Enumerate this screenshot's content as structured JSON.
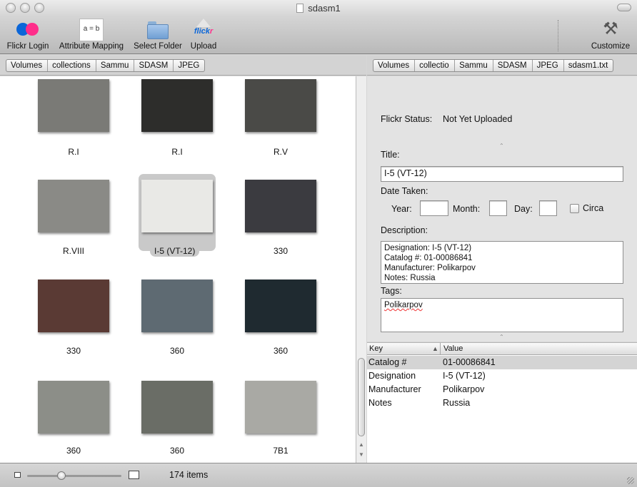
{
  "window": {
    "title": "sdasm1"
  },
  "toolbar": {
    "items": [
      {
        "label": "Flickr Login",
        "icon": "flickr-dots-icon"
      },
      {
        "label": "Attribute Mapping",
        "icon": "a-equals-b-icon",
        "icon_text": "a = b"
      },
      {
        "label": "Select Folder",
        "icon": "folder-icon"
      },
      {
        "label": "Upload",
        "icon": "flickr-upload-icon",
        "icon_text_f": "flick",
        "icon_text_r": "r"
      },
      {
        "label": "Customize",
        "icon": "tools-icon"
      }
    ]
  },
  "left_path": [
    "Volumes",
    "collections",
    "Sammu",
    "SDASM",
    "JPEG"
  ],
  "right_path": [
    "Volumes",
    "collectio",
    "Sammu",
    "SDASM",
    "JPEG",
    "sdasm1.txt"
  ],
  "grid": {
    "items": [
      {
        "caption": "R.I",
        "tone": "#7a7a76"
      },
      {
        "caption": "R.I",
        "tone": "#2d2d2b"
      },
      {
        "caption": "R.V",
        "tone": "#4a4a47"
      },
      {
        "caption": "R.VIII",
        "tone": "#8a8a86"
      },
      {
        "caption": "I-5 (VT-12)",
        "tone": "#e9e9e6",
        "selected": true
      },
      {
        "caption": "330",
        "tone": "#3b3b40"
      },
      {
        "caption": "330",
        "tone": "#5a3a34"
      },
      {
        "caption": "360",
        "tone": "#5e6a72"
      },
      {
        "caption": "360",
        "tone": "#1f2a30"
      },
      {
        "caption": "360",
        "tone": "#8c8e88"
      },
      {
        "caption": "360",
        "tone": "#6a6d66"
      },
      {
        "caption": "7B1",
        "tone": "#a9a9a4"
      }
    ]
  },
  "details": {
    "flickr_status_label": "Flickr Status:",
    "flickr_status_value": "Not Yet Uploaded",
    "title_label": "Title:",
    "title_value": "I-5 (VT-12)",
    "date_taken_label": "Date Taken:",
    "year_label": "Year:",
    "month_label": "Month:",
    "day_label": "Day:",
    "year_value": "",
    "month_value": "",
    "day_value": "",
    "circa_label": "Circa",
    "description_label": "Description:",
    "description_lines": [
      "Designation: I-5 (VT-12)",
      "Catalog #: 01-00086841",
      "Manufacturer: Polikarpov",
      "Notes: Russia"
    ],
    "tags_label": "Tags:",
    "tags_value": "Polikarpov"
  },
  "kv_table": {
    "headers": {
      "key": "Key",
      "value": "Value"
    },
    "rows": [
      {
        "key": "Catalog #",
        "value": "01-00086841"
      },
      {
        "key": "Designation",
        "value": "I-5 (VT-12)"
      },
      {
        "key": "Manufacturer",
        "value": "Polikarpov"
      },
      {
        "key": "Notes",
        "value": "Russia"
      }
    ]
  },
  "status": {
    "count": "174 items"
  }
}
